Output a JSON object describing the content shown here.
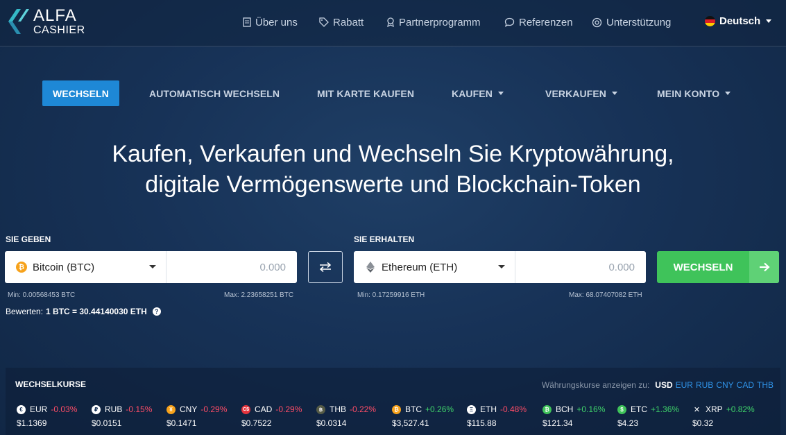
{
  "logo": {
    "line1": "ALFA",
    "line2": "CASHIER"
  },
  "topnav": [
    {
      "label": "Über uns",
      "icon": "document-icon"
    },
    {
      "label": "Rabatt",
      "icon": "tag-icon"
    },
    {
      "label": "Partnerprogramm",
      "icon": "award-icon"
    },
    {
      "label": "Referenzen",
      "icon": "speech-bubble-icon"
    },
    {
      "label": "Unterstützung",
      "icon": "support-icon"
    }
  ],
  "language": {
    "label": "Deutsch"
  },
  "mainnav": [
    {
      "label": "WECHSELN",
      "active": true
    },
    {
      "label": "AUTOMATISCH WECHSELN"
    },
    {
      "label": "MIT KARTE KAUFEN"
    },
    {
      "label": "KAUFEN",
      "dropdown": true
    },
    {
      "label": "VERKAUFEN",
      "dropdown": true
    },
    {
      "label": "MEIN KONTO",
      "dropdown": true
    }
  ],
  "hero": {
    "line1": "Kaufen, Verkaufen und Wechseln Sie Kryptowährung,",
    "line2": "digitale Vermögenswerte und Blockchain-Token"
  },
  "give": {
    "label": "SIE GEBEN",
    "currency": "Bitcoin (BTC)",
    "amount_placeholder": "0.000",
    "min": "Min: 0.00568453 BTC",
    "max": "Max: 2.23658251 BTC"
  },
  "receive": {
    "label": "SIE ERHALTEN",
    "currency": "Ethereum (ETH)",
    "amount_placeholder": "0.000",
    "min": "Min: 0.17259916 ETH",
    "max": "Max: 68.07407082 ETH"
  },
  "exchange_button": "WECHSELN",
  "rate": {
    "label": "Bewerten:",
    "value": "1 BTC = 30.44140030 ETH"
  },
  "rates_panel": {
    "title": "WECHSELKURSE",
    "currency_label": "Währungskurse anzeigen zu:",
    "selected_currency": "USD",
    "currency_options": [
      "EUR",
      "RUB",
      "CNY",
      "CAD",
      "THB"
    ],
    "tickers": [
      {
        "symbol": "EUR",
        "change": "-0.03%",
        "price": "$1.1369",
        "direction": "neg",
        "glyph": "€"
      },
      {
        "symbol": "RUB",
        "change": "-0.15%",
        "price": "$0.0151",
        "direction": "neg",
        "glyph": "₽"
      },
      {
        "symbol": "CNY",
        "change": "-0.29%",
        "price": "$0.1471",
        "direction": "neg",
        "glyph": "¥"
      },
      {
        "symbol": "CAD",
        "change": "-0.29%",
        "price": "$0.7522",
        "direction": "neg",
        "glyph": "C$"
      },
      {
        "symbol": "THB",
        "change": "-0.22%",
        "price": "$0.0314",
        "direction": "neg",
        "glyph": "฿"
      },
      {
        "symbol": "BTC",
        "change": "+0.26%",
        "price": "$3,527.41",
        "direction": "pos",
        "glyph": "₿"
      },
      {
        "symbol": "ETH",
        "change": "-0.48%",
        "price": "$115.88",
        "direction": "neg",
        "glyph": "Ξ"
      },
      {
        "symbol": "BCH",
        "change": "+0.16%",
        "price": "$121.34",
        "direction": "pos",
        "glyph": "₿"
      },
      {
        "symbol": "ETC",
        "change": "+1.36%",
        "price": "$4.23",
        "direction": "pos",
        "glyph": "$"
      },
      {
        "symbol": "XRP",
        "change": "+0.82%",
        "price": "$0.32",
        "direction": "pos",
        "glyph": "✕"
      }
    ]
  },
  "colors": {
    "accent": "#1e88d6",
    "success": "#3fc35a",
    "negative": "#ff4d67",
    "positive": "#3fd36a",
    "bitcoin": "#f7a21b"
  }
}
